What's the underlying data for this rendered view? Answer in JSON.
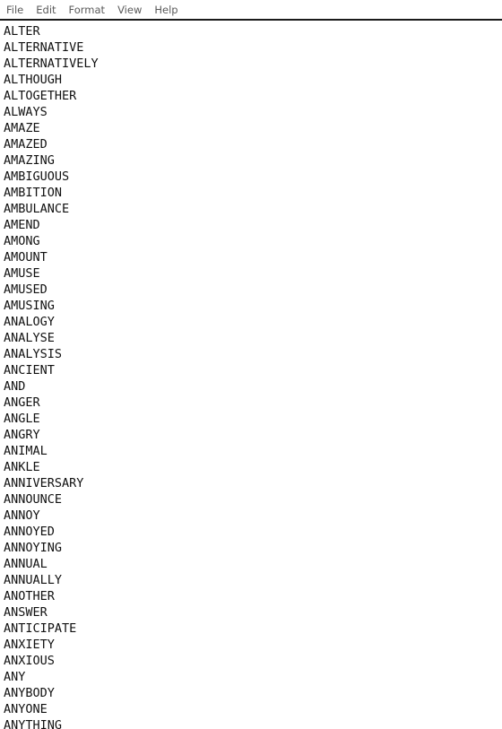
{
  "window": {
    "background_color": "#ffffff",
    "text_color": "#111111",
    "menu_text_color": "#5a5a5a",
    "separator_color": "#1b1b1b"
  },
  "menubar": {
    "items": [
      {
        "label": "File",
        "name": "menu-file"
      },
      {
        "label": "Edit",
        "name": "menu-edit"
      },
      {
        "label": "Format",
        "name": "menu-format"
      },
      {
        "label": "View",
        "name": "menu-view"
      },
      {
        "label": "Help",
        "name": "menu-help"
      }
    ]
  },
  "editor": {
    "placeholder": "",
    "lines": [
      "ALTER",
      "ALTERNATIVE",
      "ALTERNATIVELY",
      "ALTHOUGH",
      "ALTOGETHER",
      "ALWAYS",
      "AMAZE",
      "AMAZED",
      "AMAZING",
      "AMBIGUOUS",
      "AMBITION",
      "AMBULANCE",
      "AMEND",
      "AMONG",
      "AMOUNT",
      "AMUSE",
      "AMUSED",
      "AMUSING",
      "ANALOGY",
      "ANALYSE",
      "ANALYSIS",
      "ANCIENT",
      "AND",
      "ANGER",
      "ANGLE",
      "ANGRY",
      "ANIMAL",
      "ANKLE",
      "ANNIVERSARY",
      "ANNOUNCE",
      "ANNOY",
      "ANNOYED",
      "ANNOYING",
      "ANNUAL",
      "ANNUALLY",
      "ANOTHER",
      "ANSWER",
      "ANTICIPATE",
      "ANXIETY",
      "ANXIOUS",
      "ANY",
      "ANYBODY",
      "ANYONE",
      "ANYTHING"
    ]
  }
}
